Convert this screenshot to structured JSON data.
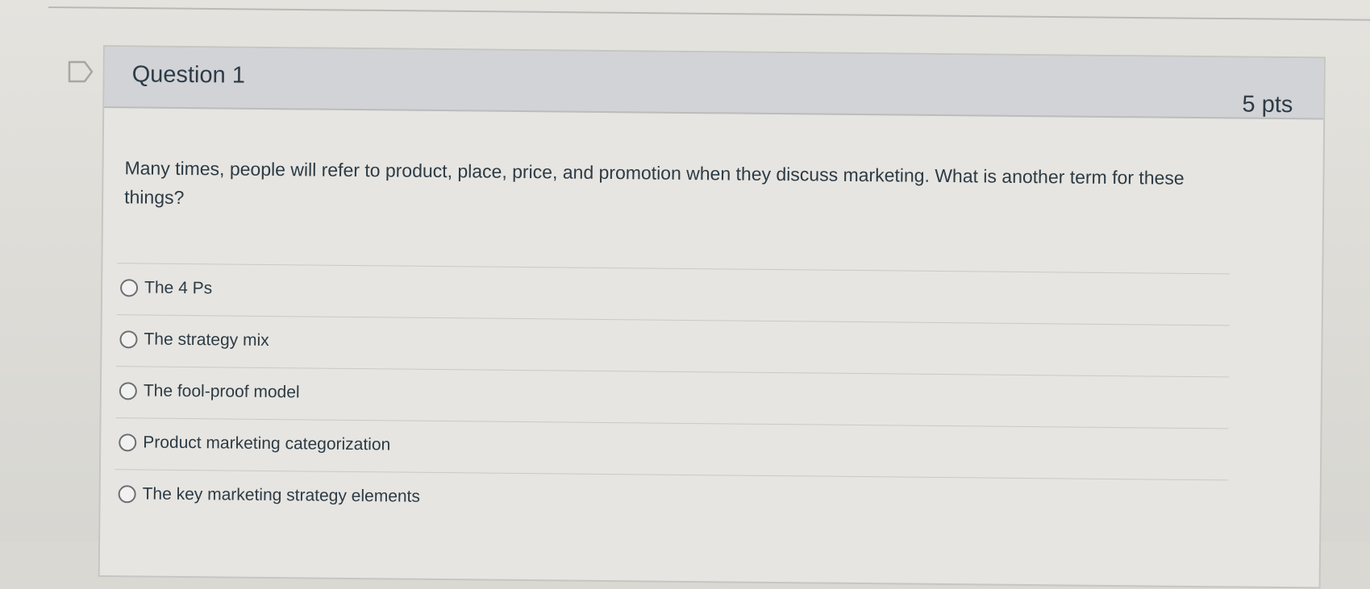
{
  "question": {
    "title": "Question 1",
    "points": "5 pts",
    "text": "Many times, people will refer to product, place, price, and promotion when they discuss marketing. What is another term for these things?",
    "answers": [
      {
        "label": "The 4 Ps",
        "selected": false
      },
      {
        "label": "The strategy mix",
        "selected": false
      },
      {
        "label": "The fool-proof model",
        "selected": false
      },
      {
        "label": "Product marketing categorization",
        "selected": false
      },
      {
        "label": "The key marketing strategy elements",
        "selected": false
      }
    ]
  },
  "icons": {
    "flag": "flag-icon"
  },
  "colors": {
    "header_background": "#d2d3d7",
    "card_background": "#e6e5e1",
    "text": "#2d3b45"
  }
}
